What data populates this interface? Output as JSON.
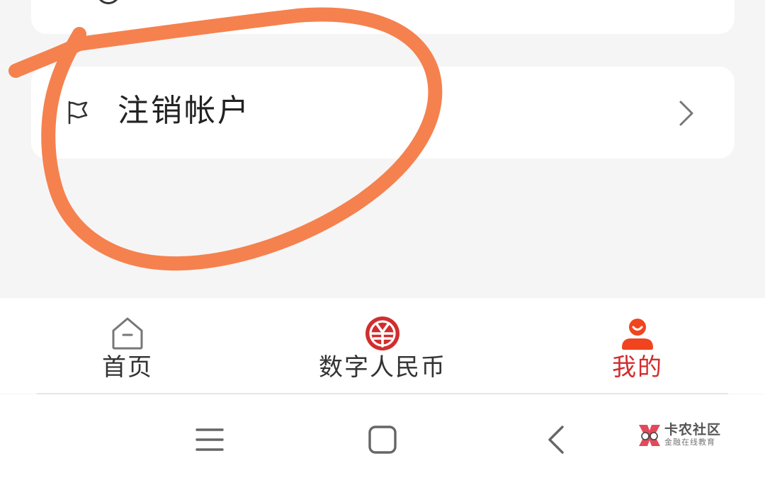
{
  "settings_list": {
    "partial_item_label": "",
    "cancel_account": {
      "icon": "flag-icon",
      "label": "注销帐户",
      "chevron_icon": "chevron-right-icon"
    }
  },
  "tab_bar": {
    "tabs": [
      {
        "id": "home",
        "label": "首页",
        "icon": "home-icon",
        "active": false
      },
      {
        "id": "ecny",
        "label": "数字人民币",
        "icon": "digital-rmb-icon",
        "active": false
      },
      {
        "id": "mine",
        "label": "我的",
        "icon": "profile-icon",
        "active": true
      }
    ],
    "active_color": "#d22d2d",
    "inactive_color": "#333333"
  },
  "system_nav": {
    "buttons": [
      {
        "id": "menu",
        "icon": "menu-icon"
      },
      {
        "id": "home",
        "icon": "square-home-icon"
      },
      {
        "id": "back",
        "icon": "back-chevron-icon"
      }
    ]
  },
  "watermark": {
    "title": "卡农社区",
    "subtitle": "金融在线教育"
  },
  "annotation": {
    "color": "#f47a46",
    "shape": "hand-drawn circle"
  }
}
